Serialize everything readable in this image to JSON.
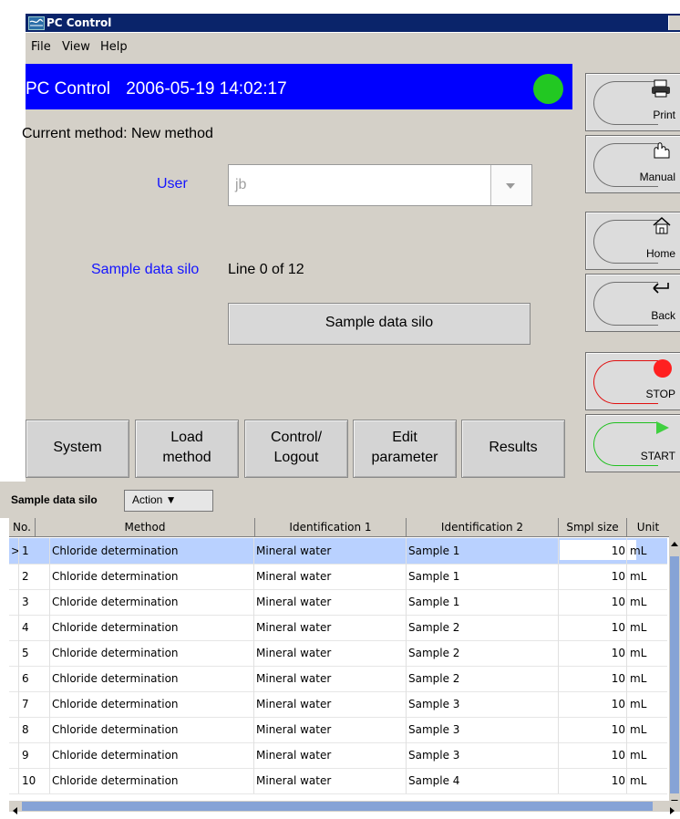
{
  "window": {
    "title": "PC Control"
  },
  "menu": {
    "items": [
      "File",
      "View",
      "Help"
    ]
  },
  "header": {
    "app": "PC Control",
    "datetime": "2006-05-19 14:02:17",
    "status_color": "#22c822"
  },
  "method": {
    "current_label": "Current method: New method"
  },
  "user": {
    "label": "User",
    "value": "jb"
  },
  "silo": {
    "label": "Sample data silo",
    "line_text": "Line 0 of 12",
    "button_label": "Sample data silo"
  },
  "nav_buttons": [
    {
      "line1": "System",
      "line2": ""
    },
    {
      "line1": "Load",
      "line2": "method"
    },
    {
      "line1": "Control/",
      "line2": "Logout"
    },
    {
      "line1": "Edit",
      "line2": "parameter"
    },
    {
      "line1": "Results",
      "line2": ""
    }
  ],
  "side_buttons": {
    "print": "Print",
    "manual": "Manual",
    "home": "Home",
    "back": "Back",
    "stop": "STOP",
    "start": "START"
  },
  "lower": {
    "title": "Sample data silo",
    "action": "Action ▼"
  },
  "table": {
    "columns": [
      "No.",
      "Method",
      "Identification 1",
      "Identification 2",
      "Smpl size",
      "Unit"
    ],
    "rows": [
      {
        "marker": ">",
        "no": "1",
        "method": "Chloride determination",
        "id1": "Mineral water",
        "id2": "Sample 1",
        "size": "10",
        "unit": "mL"
      },
      {
        "marker": "",
        "no": "2",
        "method": "Chloride determination",
        "id1": "Mineral water",
        "id2": "Sample 1",
        "size": "10",
        "unit": "mL"
      },
      {
        "marker": "",
        "no": "3",
        "method": "Chloride determination",
        "id1": "Mineral water",
        "id2": "Sample 1",
        "size": "10",
        "unit": "mL"
      },
      {
        "marker": "",
        "no": "4",
        "method": "Chloride determination",
        "id1": "Mineral water",
        "id2": "Sample 2",
        "size": "10",
        "unit": "mL"
      },
      {
        "marker": "",
        "no": "5",
        "method": "Chloride determination",
        "id1": "Mineral water",
        "id2": "Sample 2",
        "size": "10",
        "unit": "mL"
      },
      {
        "marker": "",
        "no": "6",
        "method": "Chloride determination",
        "id1": "Mineral water",
        "id2": "Sample 2",
        "size": "10",
        "unit": "mL"
      },
      {
        "marker": "",
        "no": "7",
        "method": "Chloride determination",
        "id1": "Mineral water",
        "id2": "Sample 3",
        "size": "10",
        "unit": "mL"
      },
      {
        "marker": "",
        "no": "8",
        "method": "Chloride determination",
        "id1": "Mineral water",
        "id2": "Sample 3",
        "size": "10",
        "unit": "mL"
      },
      {
        "marker": "",
        "no": "9",
        "method": "Chloride determination",
        "id1": "Mineral water",
        "id2": "Sample 3",
        "size": "10",
        "unit": "mL"
      },
      {
        "marker": "",
        "no": "10",
        "method": "Chloride determination",
        "id1": "Mineral water",
        "id2": "Sample 4",
        "size": "10",
        "unit": "mL"
      }
    ]
  }
}
